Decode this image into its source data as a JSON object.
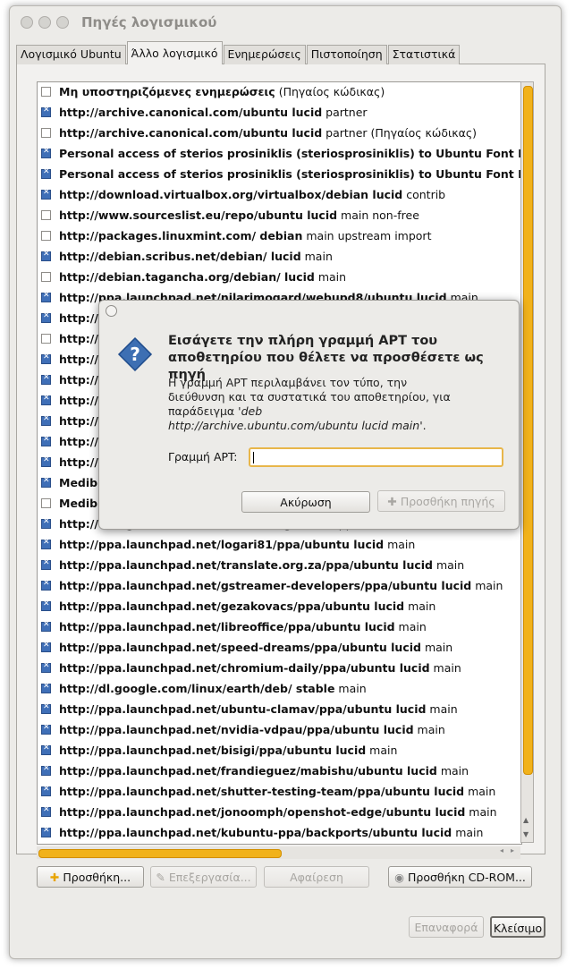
{
  "window": {
    "title": "Πηγές λογισμικού"
  },
  "tabs": [
    "Λογισμικό Ubuntu",
    "Άλλο λογισμικό",
    "Ενημερώσεις",
    "Πιστοποίηση",
    "Στατιστικά"
  ],
  "rows": [
    {
      "checked": false,
      "bold": "Μη υποστηριζόμενες ενημερώσεις",
      "rest": " (Πηγαίος κώδικας)"
    },
    {
      "checked": true,
      "bold": "http://archive.canonical.com/ubuntu lucid",
      "rest": " partner"
    },
    {
      "checked": false,
      "bold": "http://archive.canonical.com/ubuntu lucid",
      "rest": " partner (Πηγαίος κώδικας)"
    },
    {
      "checked": true,
      "bold": "Personal access of sterios prosiniklis (steriosprosiniklis) to Ubuntu Font Family B",
      "rest": ""
    },
    {
      "checked": true,
      "bold": "Personal access of sterios prosiniklis (steriosprosiniklis) to Ubuntu Font Family B",
      "rest": ""
    },
    {
      "checked": true,
      "bold": "http://download.virtualbox.org/virtualbox/debian lucid",
      "rest": " contrib"
    },
    {
      "checked": false,
      "bold": "http://www.sourceslist.eu/repo/ubuntu lucid",
      "rest": " main non-free"
    },
    {
      "checked": false,
      "bold": "http://packages.linuxmint.com/ debian",
      "rest": " main upstream import"
    },
    {
      "checked": true,
      "bold": "http://debian.scribus.net/debian/ lucid",
      "rest": " main"
    },
    {
      "checked": false,
      "bold": "http://debian.tagancha.org/debian/ lucid",
      "rest": " main"
    },
    {
      "checked": true,
      "bold": "http://ppa.launchpad.net/nilarimogard/webupd8/ubuntu lucid",
      "rest": " main"
    },
    {
      "checked": true,
      "bold": "http://pp",
      "rest": ""
    },
    {
      "checked": false,
      "bold": "http://pp",
      "rest": ""
    },
    {
      "checked": true,
      "bold": "http://pp",
      "rest": ""
    },
    {
      "checked": true,
      "bold": "http://pp",
      "rest": ""
    },
    {
      "checked": true,
      "bold": "http://pp",
      "rest": ""
    },
    {
      "checked": true,
      "bold": "http://pp",
      "rest": ""
    },
    {
      "checked": true,
      "bold": "http://pp",
      "rest": ""
    },
    {
      "checked": true,
      "bold": "http://pp",
      "rest": ""
    },
    {
      "checked": true,
      "bold": "Medibu",
      "rest": ""
    },
    {
      "checked": false,
      "bold": "Medibu",
      "rest": ""
    },
    {
      "checked": true,
      "bold": "http://deb.getdeb.net/ubuntu lucid-getdeb",
      "rest": " apps"
    },
    {
      "checked": true,
      "bold": "http://ppa.launchpad.net/logari81/ppa/ubuntu lucid",
      "rest": " main"
    },
    {
      "checked": true,
      "bold": "http://ppa.launchpad.net/translate.org.za/ppa/ubuntu lucid",
      "rest": " main"
    },
    {
      "checked": true,
      "bold": "http://ppa.launchpad.net/gstreamer-developers/ppa/ubuntu lucid",
      "rest": " main"
    },
    {
      "checked": true,
      "bold": "http://ppa.launchpad.net/gezakovacs/ppa/ubuntu lucid",
      "rest": " main"
    },
    {
      "checked": true,
      "bold": "http://ppa.launchpad.net/libreoffice/ppa/ubuntu lucid",
      "rest": " main"
    },
    {
      "checked": true,
      "bold": "http://ppa.launchpad.net/speed-dreams/ppa/ubuntu lucid",
      "rest": " main"
    },
    {
      "checked": true,
      "bold": "http://ppa.launchpad.net/chromium-daily/ppa/ubuntu lucid",
      "rest": " main"
    },
    {
      "checked": true,
      "bold": "http://dl.google.com/linux/earth/deb/ stable",
      "rest": " main"
    },
    {
      "checked": true,
      "bold": "http://ppa.launchpad.net/ubuntu-clamav/ppa/ubuntu lucid",
      "rest": " main"
    },
    {
      "checked": true,
      "bold": "http://ppa.launchpad.net/nvidia-vdpau/ppa/ubuntu lucid",
      "rest": " main"
    },
    {
      "checked": true,
      "bold": "http://ppa.launchpad.net/bisigi/ppa/ubuntu lucid",
      "rest": " main"
    },
    {
      "checked": true,
      "bold": "http://ppa.launchpad.net/frandieguez/mabishu/ubuntu lucid",
      "rest": " main"
    },
    {
      "checked": true,
      "bold": "http://ppa.launchpad.net/shutter-testing-team/ppa/ubuntu lucid",
      "rest": " main"
    },
    {
      "checked": true,
      "bold": "http://ppa.launchpad.net/jonoomph/openshot-edge/ubuntu lucid",
      "rest": " main"
    },
    {
      "checked": true,
      "bold": "http://ppa.launchpad.net/kubuntu-ppa/backports/ubuntu lucid",
      "rest": " main"
    }
  ],
  "buttons": {
    "add": "Προσθήκη...",
    "edit": "Επεξεργασία...",
    "remove": "Αφαίρεση",
    "add_cdrom": "Προσθήκη CD-ROM...",
    "revert": "Επαναφορά",
    "close": "Κλείσιμο"
  },
  "dialog": {
    "heading": "Εισάγετε την πλήρη γραμμή APT του αποθετηρίου που θέλετε να προσθέσετε ως πηγή",
    "body_plain": "Η γραμμή APT περιλαμβάνει τον τύπο, την διεύθυνση και τα συστατικά του αποθετηρίου, για παράδειγμα '",
    "body_example": "deb http://archive.ubuntu.com/ubuntu lucid main",
    "body_end": "'.",
    "label": "Γραμμή APT:",
    "input_value": "",
    "cancel": "Ακύρωση",
    "add_source": "Προσθήκη πηγής"
  }
}
